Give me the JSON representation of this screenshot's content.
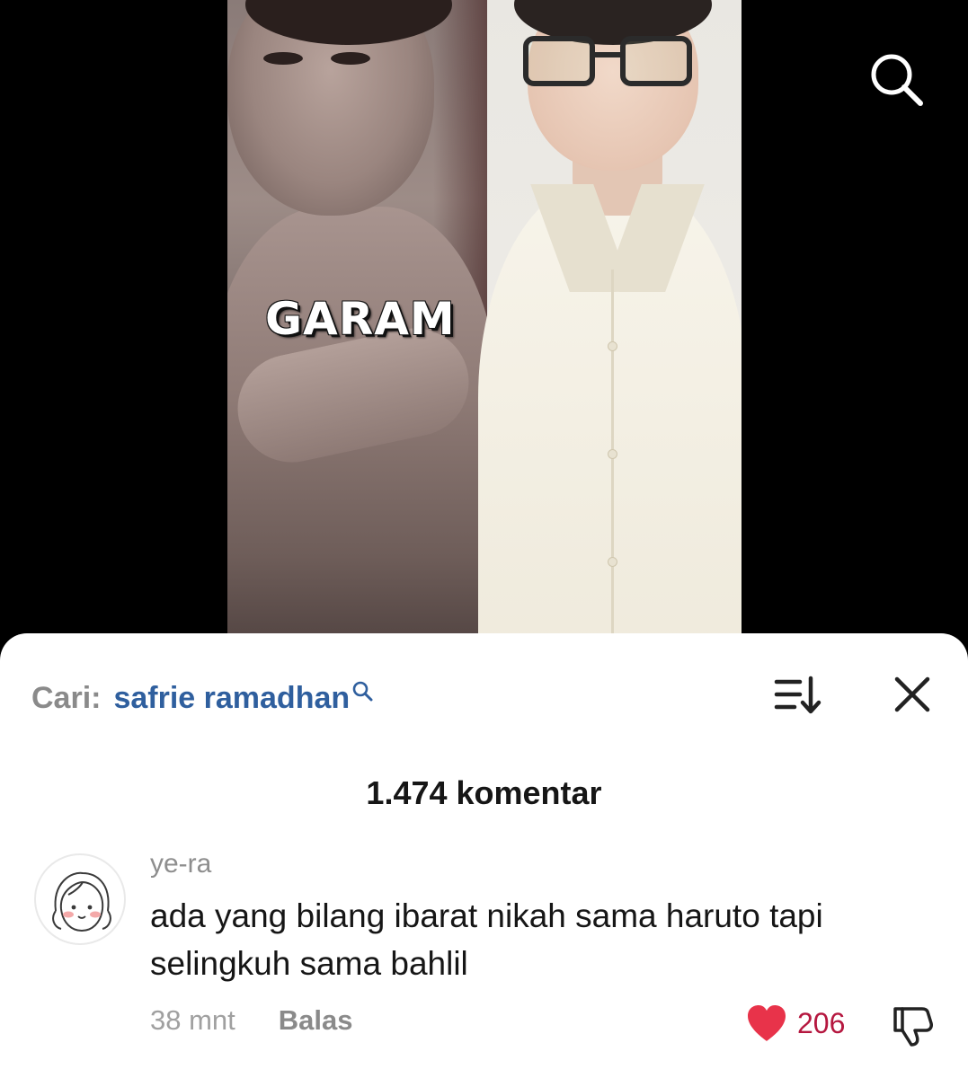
{
  "video": {
    "caption": "GARAM"
  },
  "comments_panel": {
    "search_prefix": "Cari:",
    "search_term": "safrie ramadhan",
    "count_label": "1.474 komentar",
    "comments": [
      {
        "username": "ye-ra",
        "text": "ada yang bilang ibarat nikah sama haruto tapi selingkuh sama bahlil",
        "time": "38 mnt",
        "reply_label": "Balas",
        "likes": "206",
        "liked": true
      }
    ]
  },
  "icons": [
    "search-icon",
    "sort-icon",
    "close-icon",
    "heart-icon",
    "dislike-icon"
  ],
  "colors": {
    "search_term": "#2f5f9e",
    "like": "#e8334a",
    "like_count": "#b5173f",
    "sheet_bg": "#ffffff",
    "video_bg": "#000000"
  }
}
